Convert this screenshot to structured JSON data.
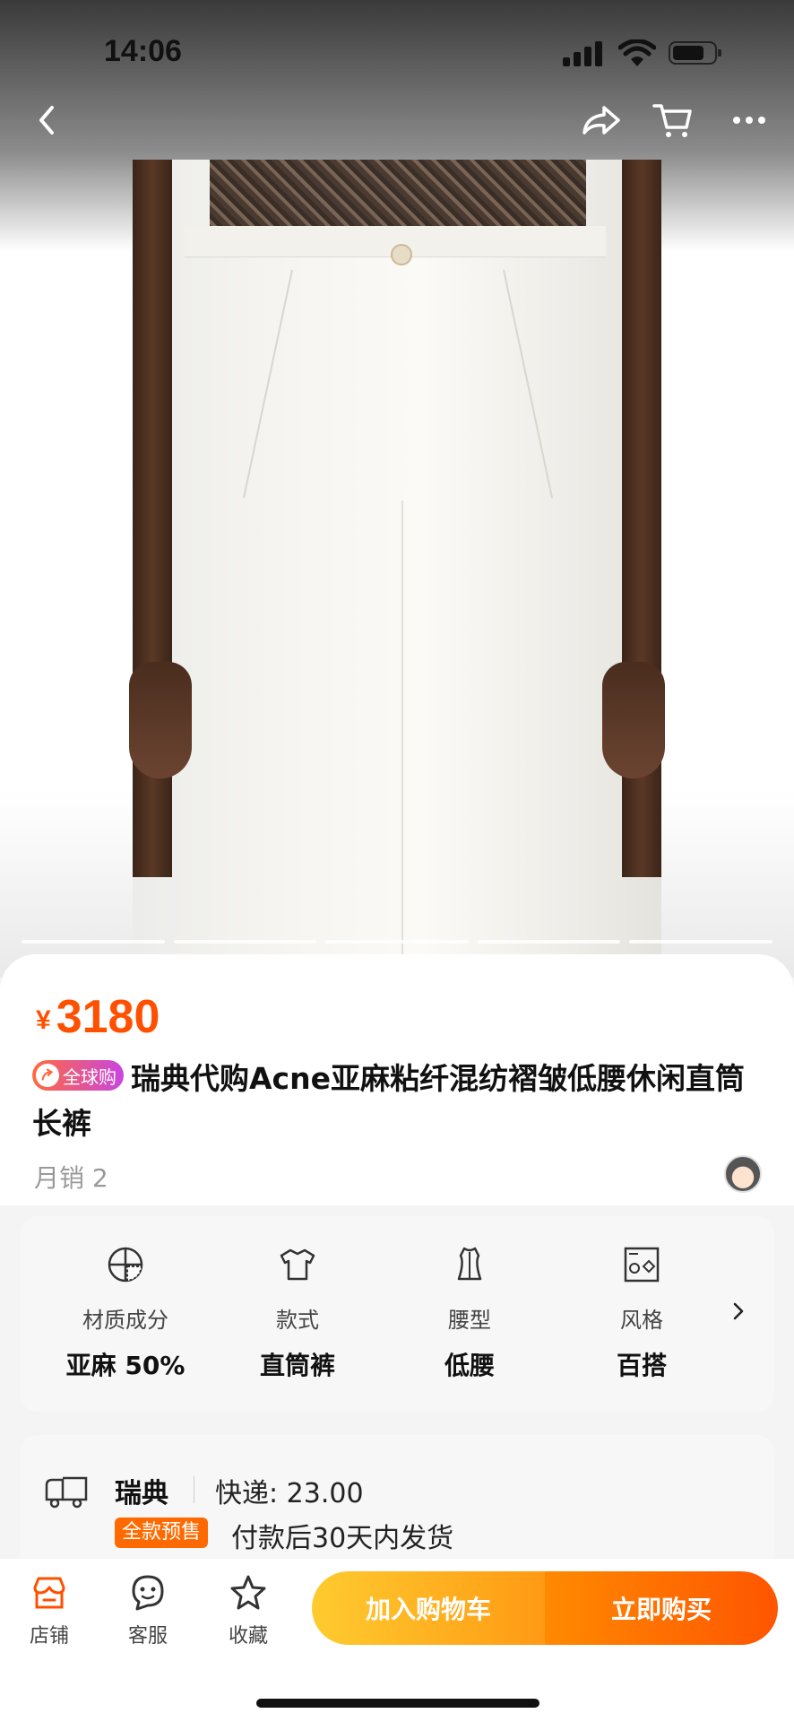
{
  "status_bar": {
    "time": "14:06"
  },
  "icons": {
    "back": "chevron-left-icon",
    "share": "share-icon",
    "cart": "cart-icon",
    "more": "more-icon"
  },
  "gallery": {
    "image_count": 5,
    "active_index": 4
  },
  "product": {
    "currency": "¥",
    "price": "3180",
    "tag": "全球购",
    "title": "瑞典代购Acne亚麻粘纤混纺褶皱低腰休闲直筒长裤",
    "monthly_sales": "月销 2"
  },
  "attributes": [
    {
      "icon": "fabric-composition-icon",
      "key": "材质成分",
      "value": "亚麻 50%"
    },
    {
      "icon": "garment-style-icon",
      "key": "款式",
      "value": "直筒裤"
    },
    {
      "icon": "waist-type-icon",
      "key": "腰型",
      "value": "低腰"
    },
    {
      "icon": "style-shapes-icon",
      "key": "风格",
      "value": "百搭"
    }
  ],
  "shipping": {
    "origin": "瑞典",
    "fee": "快递: 23.00",
    "presale_badge": "全款预售",
    "delivery": "付款后30天内发货"
  },
  "bottom_bar": {
    "shop": "店铺",
    "service": "客服",
    "favorite": "收藏",
    "add_to_cart": "加入购物车",
    "buy_now": "立即购买"
  },
  "colors": {
    "accent_orange": "#ff5000",
    "cart_button": "#ffb020",
    "buy_button": "#ff6a00"
  }
}
